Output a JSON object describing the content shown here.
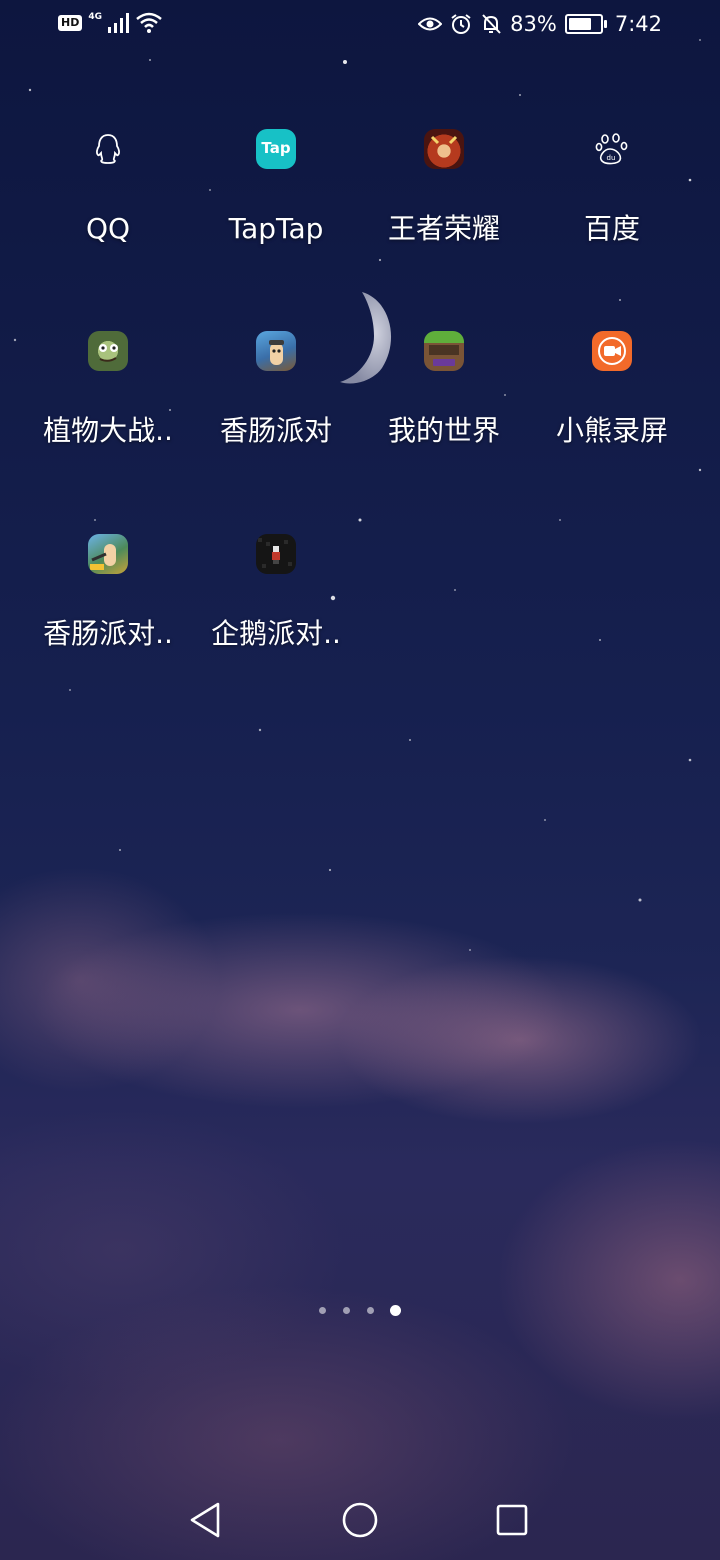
{
  "status_bar": {
    "hd": "HD",
    "network": "4G",
    "battery_percent_text": "83%",
    "battery_level": 0.83,
    "time": "7:42",
    "icons": [
      "hd-icon",
      "signal-icon",
      "wifi-icon",
      "eye-comfort-icon",
      "alarm-icon",
      "mute-bell-icon",
      "battery-icon"
    ]
  },
  "apps": [
    {
      "label": "QQ",
      "icon": "qq-penguin-icon"
    },
    {
      "label": "TapTap",
      "icon": "taptap-icon",
      "icon_text": "Tap",
      "color": "#17c1c6"
    },
    {
      "label": "王者荣耀",
      "icon": "honor-of-kings-icon"
    },
    {
      "label": "百度",
      "icon": "baidu-paw-icon"
    },
    {
      "label": "植物大战..",
      "icon": "plants-vs-zombies-icon"
    },
    {
      "label": "香肠派对",
      "icon": "sausage-party-icon"
    },
    {
      "label": "我的世界",
      "icon": "minecraft-icon"
    },
    {
      "label": "小熊录屏",
      "icon": "bear-recorder-icon",
      "color": "#f26a2a"
    },
    {
      "label": "香肠派对..",
      "icon": "sausage-party-2-icon"
    },
    {
      "label": "企鹅派对..",
      "icon": "penguin-party-icon"
    }
  ],
  "page_indicator": {
    "total": 4,
    "current": 4
  },
  "navigation": {
    "back": "back-triangle-icon",
    "home": "home-circle-icon",
    "recents": "recents-square-icon"
  }
}
